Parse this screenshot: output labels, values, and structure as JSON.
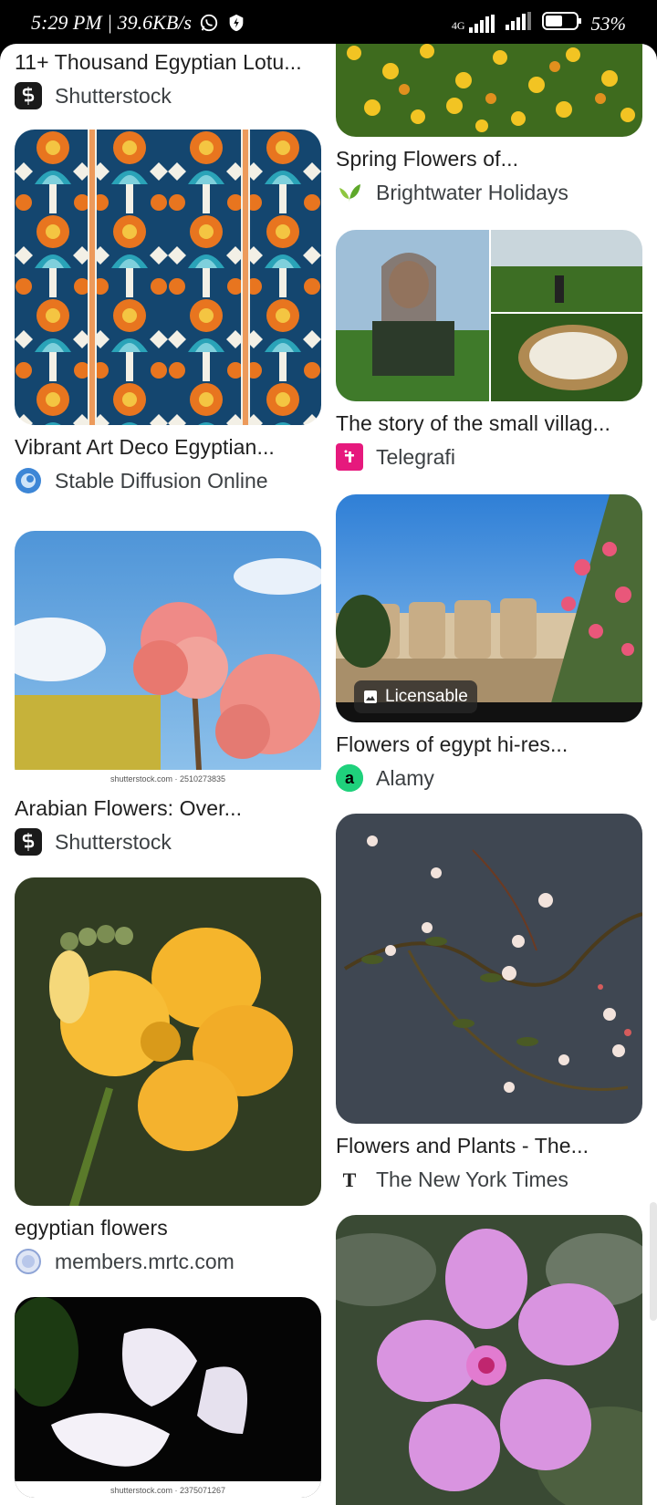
{
  "status_bar": {
    "time_speed": "5:29 PM | 39.6KB/s",
    "network": "4G",
    "battery": "53%"
  },
  "left_column": [
    {
      "title": "11+ Thousand Egyptian Lotu...",
      "source": "Shutterstock",
      "favicon": "shutterstock-icon"
    },
    {
      "title": "Vibrant Art Deco Egyptian...",
      "source": "Stable Diffusion Online",
      "favicon": "stable-diffusion-icon"
    },
    {
      "title": "Arabian Flowers: Over...",
      "source": "Shutterstock",
      "favicon": "shutterstock-icon",
      "watermark": "shutterstock.com · 2510273835"
    },
    {
      "title": "egyptian flowers",
      "source": "members.mrtc.com",
      "favicon": "globe-icon"
    },
    {
      "watermark": "shutterstock.com · 2375071267"
    }
  ],
  "right_column": [
    {
      "title": "Spring Flowers of...",
      "source": "Brightwater Holidays",
      "favicon": "leaf-icon"
    },
    {
      "title": "The story of the small villag...",
      "source": "Telegrafi",
      "favicon": "telegrafi-icon"
    },
    {
      "title": "Flowers of egypt hi-res...",
      "source": "Alamy",
      "favicon": "alamy-icon",
      "badge": "Licensable"
    },
    {
      "title": "Flowers and Plants - The...",
      "source": "The New York Times",
      "favicon": "nyt-icon"
    },
    {}
  ],
  "colors": {
    "shutterstock": "#1a1a1a",
    "telegrafi": "#e6197d",
    "alamy": "#1fd17c",
    "stable_diffusion": "#3d86d6"
  }
}
